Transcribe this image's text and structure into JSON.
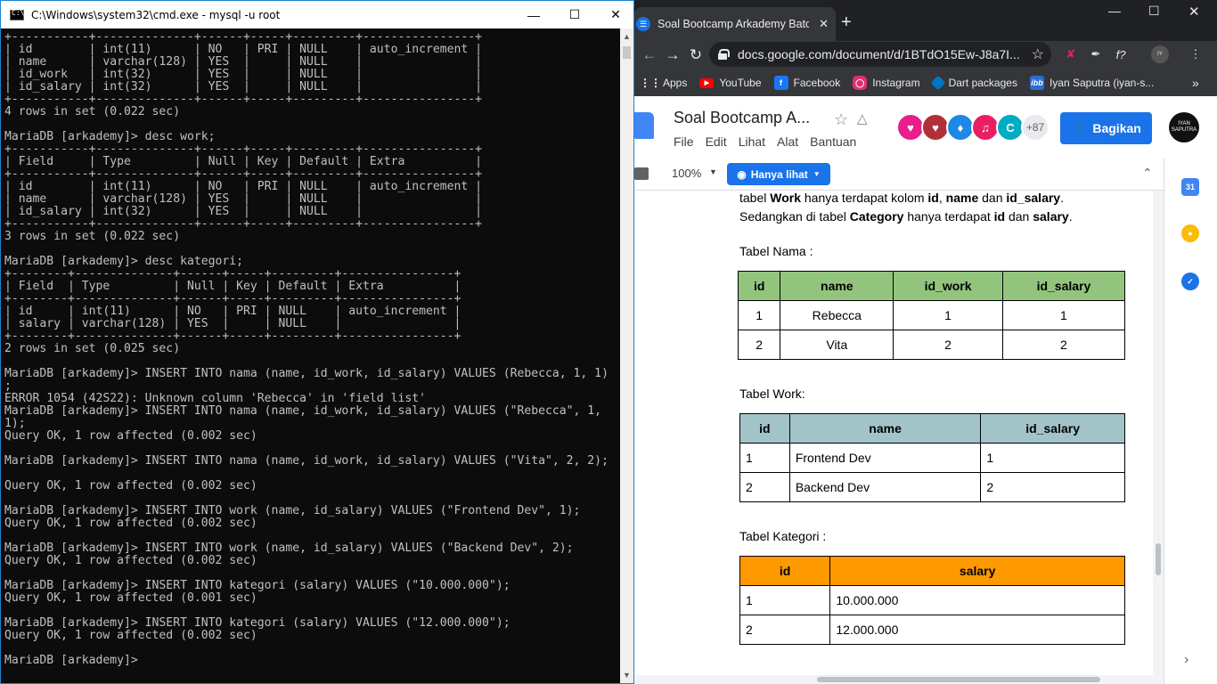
{
  "cmd": {
    "title": "C:\\Windows\\system32\\cmd.exe - mysql  -u root",
    "lines": [
      "+-----------+--------------+------+-----+---------+----------------+",
      "| id        | int(11)      | NO   | PRI | NULL    | auto_increment |",
      "| name      | varchar(128) | YES  |     | NULL    |                |",
      "| id_work   | int(32)      | YES  |     | NULL    |                |",
      "| id_salary | int(32)      | YES  |     | NULL    |                |",
      "+-----------+--------------+------+-----+---------+----------------+",
      "4 rows in set (0.022 sec)",
      "",
      "MariaDB [arkademy]> desc work;",
      "+-----------+--------------+------+-----+---------+----------------+",
      "| Field     | Type         | Null | Key | Default | Extra          |",
      "+-----------+--------------+------+-----+---------+----------------+",
      "| id        | int(11)      | NO   | PRI | NULL    | auto_increment |",
      "| name      | varchar(128) | YES  |     | NULL    |                |",
      "| id_salary | int(32)      | YES  |     | NULL    |                |",
      "+-----------+--------------+------+-----+---------+----------------+",
      "3 rows in set (0.022 sec)",
      "",
      "MariaDB [arkademy]> desc kategori;",
      "+--------+--------------+------+-----+---------+----------------+",
      "| Field  | Type         | Null | Key | Default | Extra          |",
      "+--------+--------------+------+-----+---------+----------------+",
      "| id     | int(11)      | NO   | PRI | NULL    | auto_increment |",
      "| salary | varchar(128) | YES  |     | NULL    |                |",
      "+--------+--------------+------+-----+---------+----------------+",
      "2 rows in set (0.025 sec)",
      "",
      "MariaDB [arkademy]> INSERT INTO nama (name, id_work, id_salary) VALUES (Rebecca, 1, 1)",
      ";",
      "ERROR 1054 (42S22): Unknown column 'Rebecca' in 'field list'",
      "MariaDB [arkademy]> INSERT INTO nama (name, id_work, id_salary) VALUES (\"Rebecca\", 1,",
      "1);",
      "Query OK, 1 row affected (0.002 sec)",
      "",
      "MariaDB [arkademy]> INSERT INTO nama (name, id_work, id_salary) VALUES (\"Vita\", 2, 2);",
      "",
      "Query OK, 1 row affected (0.002 sec)",
      "",
      "MariaDB [arkademy]> INSERT INTO work (name, id_salary) VALUES (\"Frontend Dev\", 1);",
      "Query OK, 1 row affected (0.002 sec)",
      "",
      "MariaDB [arkademy]> INSERT INTO work (name, id_salary) VALUES (\"Backend Dev\", 2);",
      "Query OK, 1 row affected (0.002 sec)",
      "",
      "MariaDB [arkademy]> INSERT INTO kategori (salary) VALUES (\"10.000.000\");",
      "Query OK, 1 row affected (0.001 sec)",
      "",
      "MariaDB [arkademy]> INSERT INTO kategori (salary) VALUES (\"12.000.000\");",
      "Query OK, 1 row affected (0.002 sec)",
      "",
      "MariaDB [arkademy]>"
    ]
  },
  "chrome": {
    "tab_title": "Soal Bootcamp Arkademy Batch",
    "url": "docs.google.com/document/d/1BTdO15Ew-J8a7I...",
    "bookmarks": [
      {
        "label": "Apps",
        "icon": "apps-grid-icon",
        "color": "#e8eaed"
      },
      {
        "label": "YouTube",
        "icon": "youtube-icon",
        "color": "#ff0000"
      },
      {
        "label": "Facebook",
        "icon": "facebook-icon",
        "color": "#1877f2"
      },
      {
        "label": "Instagram",
        "icon": "instagram-icon",
        "color": "#e1306c"
      },
      {
        "label": "Dart packages",
        "icon": "dart-icon",
        "color": "#0175c2"
      },
      {
        "label": "Iyan Saputra (iyan-s...",
        "icon": "ibb-icon",
        "color": "#2b6dd1"
      }
    ]
  },
  "docs": {
    "title": "Soal Bootcamp A...",
    "menu": [
      "File",
      "Edit",
      "Lihat",
      "Alat",
      "Bantuan"
    ],
    "share_label": "Bagikan",
    "collaborators_more": "+87",
    "account_label": "IYAN SAPUTRA",
    "zoom": "100%",
    "mode": "Hanya lihat",
    "intro_line1": {
      "a": "tabel ",
      "b1": "Work",
      "c": " hanya terdapat kolom ",
      "b2": "id",
      "d": ", ",
      "b3": "name",
      "e": " dan ",
      "b4": "id_salary",
      "f": "."
    },
    "intro_line2": {
      "a": "Sedangkan di tabel ",
      "b1": "Category",
      "c": " hanya terdapat ",
      "b2": "id",
      "d": " dan ",
      "b3": "salary",
      "e": "."
    },
    "table_nama": {
      "caption": "Tabel Nama :",
      "header_color": "#93c47d",
      "headers": [
        "id",
        "name",
        "id_work",
        "id_salary"
      ],
      "rows": [
        [
          "1",
          "Rebecca",
          "1",
          "1"
        ],
        [
          "2",
          "Vita",
          "2",
          "2"
        ]
      ]
    },
    "table_work": {
      "caption": "Tabel Work:",
      "header_color": "#a2c4c9",
      "headers": [
        "id",
        "name",
        "id_salary"
      ],
      "rows": [
        [
          "1",
          "Frontend Dev",
          "1"
        ],
        [
          "2",
          "Backend Dev",
          "2"
        ]
      ]
    },
    "table_kategori": {
      "caption": "Tabel Kategori :",
      "header_color": "#ff9900",
      "headers": [
        "id",
        "salary"
      ],
      "rows": [
        [
          "1",
          "10.000.000"
        ],
        [
          "2",
          "12.000.000"
        ]
      ]
    }
  }
}
